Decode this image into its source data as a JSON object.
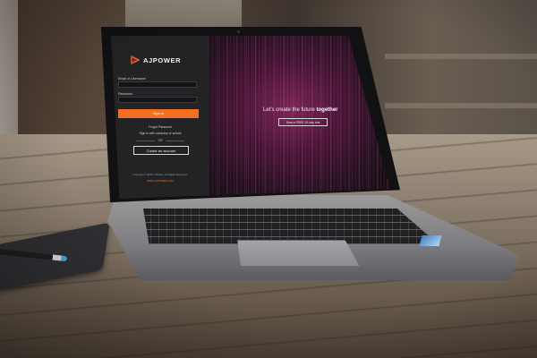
{
  "brand": {
    "name": "AJPOWER",
    "accent_color": "#f36f21"
  },
  "login": {
    "email_label": "Email or Username",
    "password_label": "Password",
    "signin_label": "Sign in",
    "forgot_label": "Forgot Password",
    "sso_label": "Sign in with company or school",
    "or_label": "OR",
    "create_label": "Create an account",
    "copyright": "Copyright © 2016, AJPower. All Rights Reserved.",
    "footer_link": "WWW.AJPOWER.COM"
  },
  "hero": {
    "title_prefix": "Let's create the future ",
    "title_emphasis": "together",
    "trial_label": "Start a FREE 15-day trial"
  },
  "icons": {
    "logo": "play-triangle-icon"
  }
}
